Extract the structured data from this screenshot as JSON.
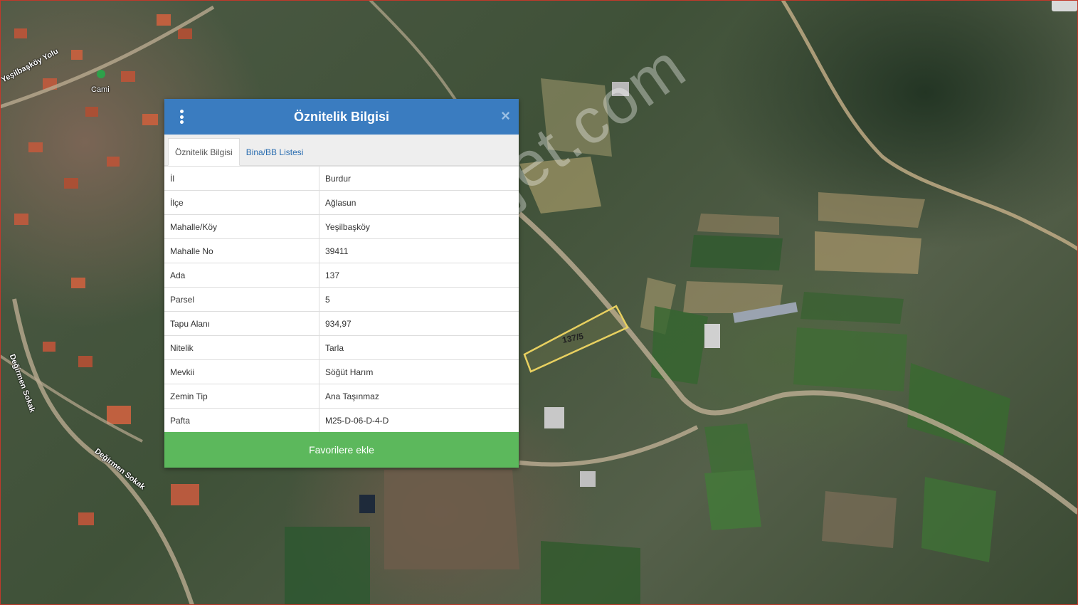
{
  "map": {
    "parcel_label": "137/5",
    "watermark": "emlakjet.com",
    "place_label": "Cami",
    "road_labels": [
      "Yeşilbaşköy Yolu",
      "Değirmen Sokak",
      "Değirmen Sokak"
    ]
  },
  "panel": {
    "title": "Öznitelik Bilgisi",
    "close_symbol": "×",
    "tabs": [
      {
        "label": "Öznitelik Bilgisi",
        "active": true
      },
      {
        "label": "Bina/BB Listesi",
        "active": false
      }
    ],
    "rows": [
      {
        "key": "İl",
        "value": "Burdur"
      },
      {
        "key": "İlçe",
        "value": "Ağlasun"
      },
      {
        "key": "Mahalle/Köy",
        "value": "Yeşilbaşköy"
      },
      {
        "key": "Mahalle No",
        "value": "39411"
      },
      {
        "key": "Ada",
        "value": "137"
      },
      {
        "key": "Parsel",
        "value": "5"
      },
      {
        "key": "Tapu Alanı",
        "value": "934,97"
      },
      {
        "key": "Nitelik",
        "value": "Tarla"
      },
      {
        "key": "Mevkii",
        "value": "Söğüt Harım"
      },
      {
        "key": "Zemin Tip",
        "value": "Ana Taşınmaz"
      },
      {
        "key": "Pafta",
        "value": "M25-D-06-D-4-D"
      }
    ],
    "favorite_button": "Favorilere ekle"
  },
  "colors": {
    "header": "#3a7cc0",
    "button": "#5cb85c",
    "parcel_outline": "#e8d060"
  }
}
